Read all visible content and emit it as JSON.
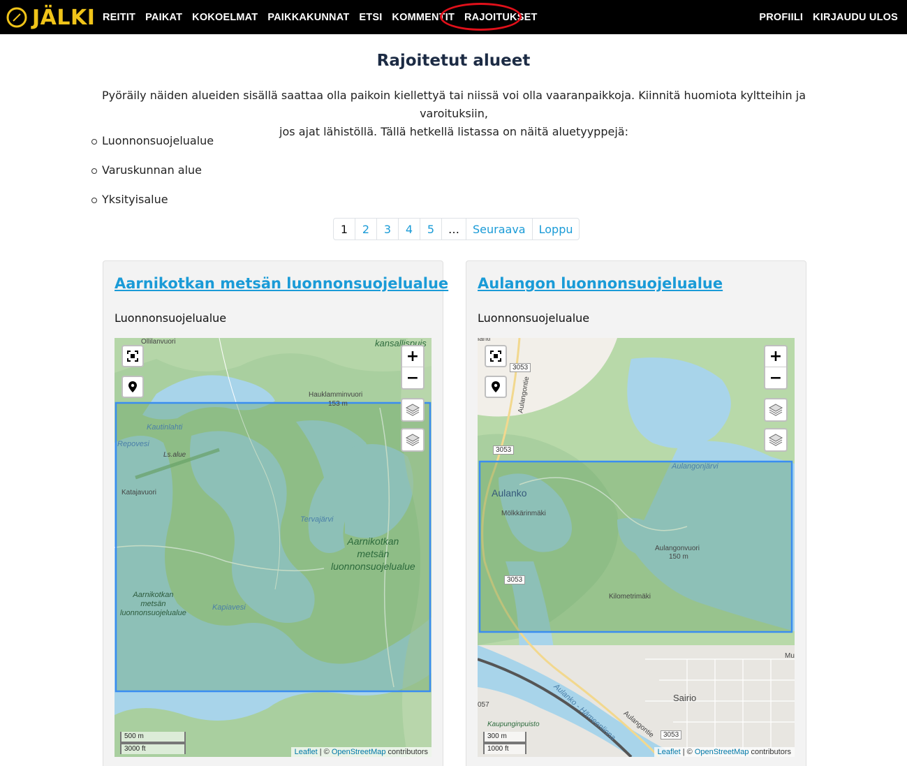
{
  "brand": {
    "name": "JÄLKI",
    "logo_icon": "compass-icon",
    "color": "#f0c419"
  },
  "nav": {
    "left": [
      "REITIT",
      "PAIKAT",
      "KOKOELMAT",
      "PAIKKAKUNNAT",
      "ETSI",
      "KOMMENTIT",
      "RAJOITUKSET"
    ],
    "right": [
      "PROFIILI",
      "KIRJAUDU ULOS"
    ],
    "highlighted": "RAJOITUKSET"
  },
  "page": {
    "title": "Rajoitetut alueet",
    "intro_line1": "Pyöräily näiden alueiden sisällä saattaa olla paikoin kiellettyä tai niissä voi olla vaaranpaikkoja. Kiinnitä huomiota kyltteihin ja varoituksiin,",
    "intro_line2": "jos ajat lähistöllä. Tällä hetkellä listassa on näitä aluetyyppejä:",
    "area_types": [
      "Luonnonsuojelualue",
      "Varuskunnan alue",
      "Yksityisalue"
    ]
  },
  "pagination": {
    "pages": [
      "1",
      "2",
      "3",
      "4",
      "5"
    ],
    "active": "1",
    "ellipsis": "…",
    "next": "Seuraava",
    "last": "Loppu"
  },
  "cards": [
    {
      "title": "Aarnikotkan metsän luonnonsuojelualue",
      "type": "Luonnonsuojelualue",
      "map": {
        "labels": {
          "top_left": "Ollilanvuori",
          "park": "kansallispuis",
          "hill": "Hauklamminvuori",
          "hill_height": "153 m",
          "bay": "Kautinlahti",
          "lake1": "Repovesi",
          "ls": "Ls.alue",
          "kata": "Katajavuori",
          "lake2": "Tervajärvi",
          "area_name_1": "Aarnikotkan",
          "area_name_2": "metsän",
          "area_name_3": "luonnonsuojelualue",
          "lake3": "Kapiavesi"
        },
        "scale_metric": "500 m",
        "scale_imperial": "3000 ft",
        "attribution_leaflet": "Leaflet",
        "attribution_sep": " | © ",
        "attribution_osm": "OpenStreetMap",
        "attribution_tail": " contributors"
      }
    },
    {
      "title": "Aulangon luonnonsuojelualue",
      "type": "Luonnonsuojelualue",
      "map": {
        "labels": {
          "top_left": "lahti",
          "road_1": "3053",
          "road_2": "3053",
          "road_3": "3053",
          "road_4": "3053",
          "street": "Aulangontie",
          "lake": "Aulangonjärvi",
          "place": "Aulanko",
          "molk": "Mölkkärinmäki",
          "hill": "Aulangonvuori",
          "hill_height": "150 m",
          "kilo": "Kilometrimäki",
          "town": "Sairio",
          "park": "Kaupunginpuisto",
          "r57": "057",
          "street2": "Aulangontie",
          "river": "Aulanko - Hämeenlinna",
          "mu": "Mu"
        },
        "scale_metric": "300 m",
        "scale_imperial": "1000 ft",
        "attribution_leaflet": "Leaflet",
        "attribution_sep": " | © ",
        "attribution_osm": "OpenStreetMap",
        "attribution_tail": " contributors"
      }
    }
  ],
  "icons": {
    "fullscreen": "fullscreen-icon",
    "locate": "location-pin-icon",
    "layers": "layers-icon",
    "zoom_in": "+",
    "zoom_out": "−"
  },
  "colors": {
    "navbar": "#000000",
    "link": "#1a9bd7",
    "title": "#1c2b44",
    "highlight_circle": "#e0101a",
    "restricted_area": "#3a8df0",
    "water": "#a8d4ea",
    "forest": "#a9cf9f"
  }
}
